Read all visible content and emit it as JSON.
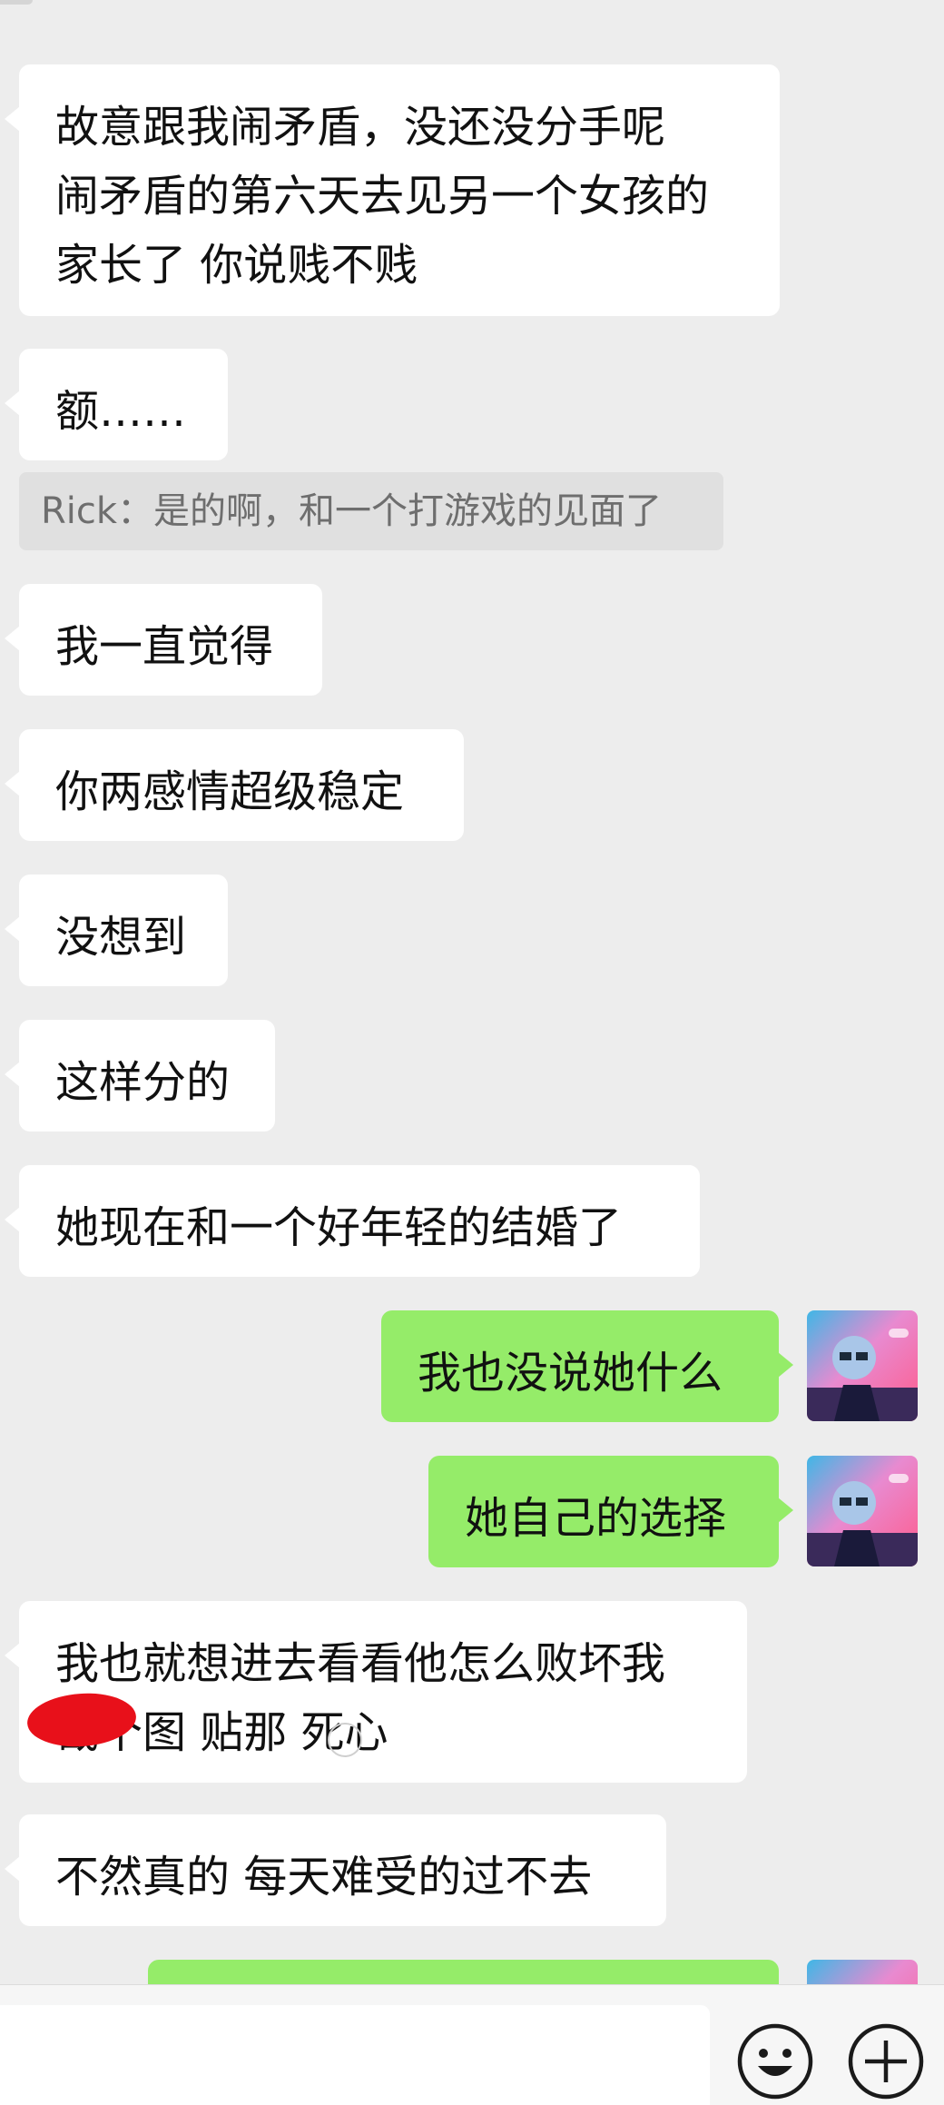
{
  "messages": [
    {
      "side": "in",
      "lines": [
        "故意跟我闹矛盾，没还没分手呢",
        "闹矛盾的第六天去见另一个女孩的",
        "家长了 你说贱不贱"
      ]
    },
    {
      "side": "in",
      "lines": [
        "额……"
      ]
    },
    {
      "side": "quote",
      "text": "Rick：是的啊，和一个打游戏的见面了"
    },
    {
      "side": "in",
      "lines": [
        "我一直觉得"
      ]
    },
    {
      "side": "in",
      "lines": [
        "你两感情超级稳定"
      ]
    },
    {
      "side": "in",
      "lines": [
        "没想到"
      ]
    },
    {
      "side": "in",
      "lines": [
        "这样分的"
      ]
    },
    {
      "side": "in",
      "lines": [
        "她现在和一个好年轻的结婚了"
      ]
    },
    {
      "side": "out",
      "lines": [
        "我也没说她什么"
      ]
    },
    {
      "side": "out",
      "lines": [
        "她自己的选择"
      ]
    },
    {
      "side": "in",
      "lines": [
        "我也就想进去看看他怎么败坏我",
        "截个图 贴那 死心"
      ]
    },
    {
      "side": "in",
      "lines": [
        "不然真的 每天难受的过不去"
      ]
    },
    {
      "side": "out",
      "lines": [
        ""
      ]
    }
  ],
  "input_bar": {
    "emoji_icon": "smiley-face-icon",
    "plus_icon": "plus-circle-icon"
  },
  "colors": {
    "background": "#ededed",
    "incoming_bubble": "#ffffff",
    "outgoing_bubble": "#95ec69",
    "quote_bg": "#e0e0e0",
    "redaction": "#e8101a"
  }
}
